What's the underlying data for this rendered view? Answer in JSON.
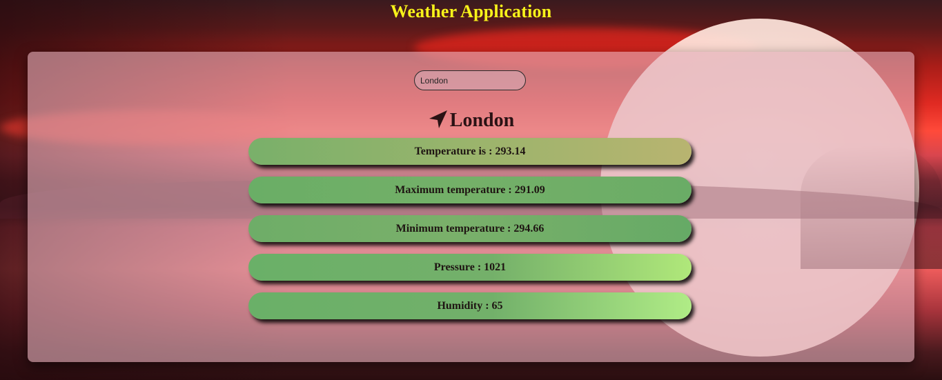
{
  "app": {
    "title": "Weather Application"
  },
  "search": {
    "value": "London"
  },
  "location": {
    "icon": "location-arrow-icon",
    "city": "London"
  },
  "weather": {
    "items": [
      {
        "label": "Temperature is : 293.14"
      },
      {
        "label": "Maximum temperature : 291.09"
      },
      {
        "label": "Minimum temperature : 294.66"
      },
      {
        "label": "Pressure : 1021"
      },
      {
        "label": "Humidity : 65"
      }
    ]
  },
  "colors": {
    "title": "#f7f21a",
    "card_green": "#6aae66",
    "panel": "#e1afb9"
  }
}
